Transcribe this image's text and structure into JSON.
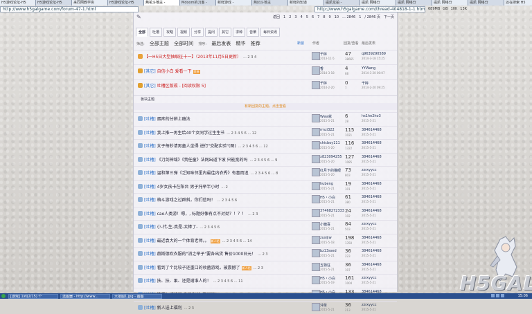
{
  "browser": {
    "tabs": [
      "H5游戏论坛-H5",
      "H5游戏论坛-H5",
      "来同网教学资",
      "H5游戏论坛-H5",
      "燕花斗地主 -",
      "Mdoom的刀客 -",
      "新鲜游戏 -",
      "燕凹斗地主",
      "新鲜的知道",
      "提凯龙拍 -",
      "提凯 网络分",
      "提凯 网络分",
      "提凯 网络分",
      "提凯 网络分",
      "还在搜索 H5"
    ],
    "active_tab_index": 4,
    "address_left": "http://www.h5galgame.com/forum-47-1.html",
    "address_right": "http://www.h5galgame.com/thread-404818-1-1.html",
    "right_info": [
      "689MB",
      "GB",
      "10K",
      "13K"
    ]
  },
  "pager": {
    "return": "返回",
    "pages": [
      "1",
      "2",
      "3",
      "4",
      "5",
      "6",
      "7",
      "8",
      "9",
      "10",
      "... 2846"
    ],
    "goto": "1",
    "total": "/ 2846 页",
    "next": "下一页"
  },
  "nav": {
    "tabs": [
      "全部",
      "吐槽",
      "攻略",
      "视频",
      "分享",
      "提问",
      "其它",
      "求种",
      "音樂",
      "每日资讯"
    ],
    "active_index": 0
  },
  "filter": {
    "label_left": "筛选:",
    "all": "全部主题",
    "all_time": "全部时间",
    "label_sort": "排序:",
    "last_post": "最后发表",
    "digest": "精华",
    "recommend": "推荐",
    "new": "新窗"
  },
  "columns": {
    "author": "作者",
    "replies": "回复/查看",
    "last": "最后发表"
  },
  "pinned": [
    {
      "icon": "up",
      "tag": "",
      "title": "【一H5日大型抽取征十一】（2013年11月5日更新）",
      "title_color": "red",
      "pages": "2 3 4",
      "author": "千碎",
      "date": "2013-11-5",
      "replies": "47",
      "views": "38665",
      "last": "q9639290589",
      "last_date": "2014-3-18 15:25"
    },
    {
      "icon": "lock",
      "tag": "[其它]",
      "title": "自信小白 爱看一下",
      "title_color": "red",
      "badge": "资源",
      "pages": "",
      "author": "香",
      "date": "2014-3-18",
      "replies": "4",
      "views": "68",
      "last": "YYWang",
      "last_date": "2014-3-20 00:07"
    },
    {
      "icon": "lock",
      "tag": "[其它]",
      "title": "吐槽区版规 - [阅读权限 5]",
      "title_color": "red",
      "pages": "",
      "author": "千碎",
      "date": "2014-2-20",
      "replies": "0",
      "views": "7",
      "last": "千碎",
      "last_date": "2014-2-20 09:25"
    }
  ],
  "section_label": "板块主题",
  "new_notice": "有新回复的主题，点击查看",
  "threads": [
    {
      "tag": "[吐槽]",
      "title": "蛋疼的分辨上瘾法",
      "pages": "",
      "author": "Wwa就",
      "date": "2015-5-21",
      "replies": "6",
      "views": "28",
      "last": "hs1he2ho3",
      "last_date": "2015-5-21"
    },
    {
      "tag": "[吐槽]",
      "title": "我上推一男生给40个女同学过生生节",
      "pages": "2 3 4 5 6 ... 12",
      "author": "rrnzi322",
      "date": "2015-5-21",
      "replies": "115",
      "views": "1021",
      "last": "384614468",
      "last_date": "2015-5-21"
    },
    {
      "tag": "[吐槽]",
      "title": "女子每秒请男童人坐得 进行\"交配实验\"(图)",
      "pages": "2 3 4 5 6 ... 12",
      "author": "chicboy111",
      "date": "2015-5-20",
      "replies": "116",
      "views": "1322",
      "last": "384614468",
      "last_date": "2015-5-21"
    },
    {
      "tag": "[吐槽]",
      "title": "《刀剑神域》《责任童》法网出道下坡 只能宽的吗",
      "pages": "2 3 4 5 6 ... 9",
      "author": "x823094255",
      "date": "2015-5-20",
      "replies": "127",
      "views": "1085",
      "last": "384614468",
      "last_date": "2015-5-21"
    },
    {
      "tag": "[吐槽]",
      "title": "温和第三弹《乏知味邻里内最佳内衣秀》有喜而追",
      "pages": "2 3 4 5 6 ... 8",
      "author": "红月下的猫眼",
      "date": "2015-5-20",
      "replies": "73",
      "views": "803",
      "last": "zzrxyycc",
      "last_date": "2015-5-21"
    },
    {
      "tag": "[吐槽]",
      "title": "4岁女孩卡在阳台 男子托举半小时",
      "pages": "2",
      "author": "hubeng",
      "date": "2015-5-21",
      "replies": "19",
      "views": "101",
      "last": "384614468",
      "last_date": "2015-5-21"
    },
    {
      "tag": "[吐槽]",
      "title": "格斗游戏之过群斜，你们信吗！",
      "pages": "2 3 4 5 6",
      "author": "H5・小白",
      "date": "2015-5-21",
      "replies": "61",
      "views": "380",
      "last": "384614468",
      "last_date": "2015-5-21"
    },
    {
      "tag": "[吐槽]",
      "title": "cao人类游！嗯，, 标题好像有点不对劲？！？！",
      "pages": "2 3",
      "author": "37468272333",
      "date": "2015-5-21",
      "replies": "24",
      "views": "102",
      "last": "384614468",
      "last_date": "2015-5-21"
    },
    {
      "tag": "[吐槽]",
      "title": "小-代-生-真是-太棒了-",
      "pages": "2 3 4 5 6",
      "author": "小慵喜",
      "date": "2015-5-21",
      "replies": "84",
      "views": "503",
      "last": "zzrxyycc",
      "last_date": "2015-5-21"
    },
    {
      "tag": "[吐槽]",
      "title": "最近袁大的一个体育老师。。",
      "badge": "新人帖",
      "pages": "2 3 4 5 6 ... 14",
      "author": "zusijiw",
      "date": "2015-5-18",
      "replies": "198",
      "views": "1350",
      "last": "384614468",
      "last_date": "2015-5-21"
    },
    {
      "tag": "[吐槽]",
      "title": "赫斯德吹衣服的\"消之举子\"要各出货 售价1000日元！",
      "pages": "2 3",
      "author": "bz13ssed",
      "date": "2015-5-21",
      "replies": "36",
      "views": "223",
      "last": "384614468",
      "last_date": "2015-5-21"
    },
    {
      "tag": "[吐槽]",
      "title": "看到了个比较子还重口的收菌游戏，被震撼了",
      "badge": "新人帖",
      "pages": "2 3",
      "author": "五物狂",
      "date": "2015-5-21",
      "replies": "36",
      "views": "197",
      "last": "384614468",
      "last_date": "2015-5-21"
    },
    {
      "tag": "[吐槽]",
      "title": "扶、扶、果、还是谢谁人的！",
      "pages": "2 3 4 5 6 ... 11",
      "author": "H5・小白",
      "date": "2015-5-19",
      "replies": "161",
      "views": "1004",
      "last": "zzrxyycc",
      "last_date": "2015-5-21"
    },
    {
      "tag": "[吐槽]",
      "title": "快看！妹妹居 身了当 泳 都退了！",
      "pages": "2 3 4 5 6 ... 9",
      "author": "H5・小白",
      "date": "2015-5-19",
      "replies": "133",
      "views": "810",
      "last": "384614468",
      "last_date": "2015-5-21"
    },
    {
      "tag": "[吐槽]",
      "title": "新人送上福利",
      "pages": "2 3",
      "author": "沖茶",
      "date": "2015-5-21",
      "replies": "36",
      "views": "213",
      "last": "zzrxyycc",
      "last_date": "2015-5-21"
    }
  ],
  "taskbar": {
    "items": [
      "[游戏] 1列(2/15) 个",
      "选图器 - http://www...",
      "大拾图1.jpg - 画图"
    ],
    "clock": "15:06"
  },
  "logo_text": "H5GAL",
  "colors": {
    "accent": "#2a6fc9",
    "red": "#cc1f1f",
    "badge": "#f0a040",
    "taskbar": "#2a4f8e"
  }
}
